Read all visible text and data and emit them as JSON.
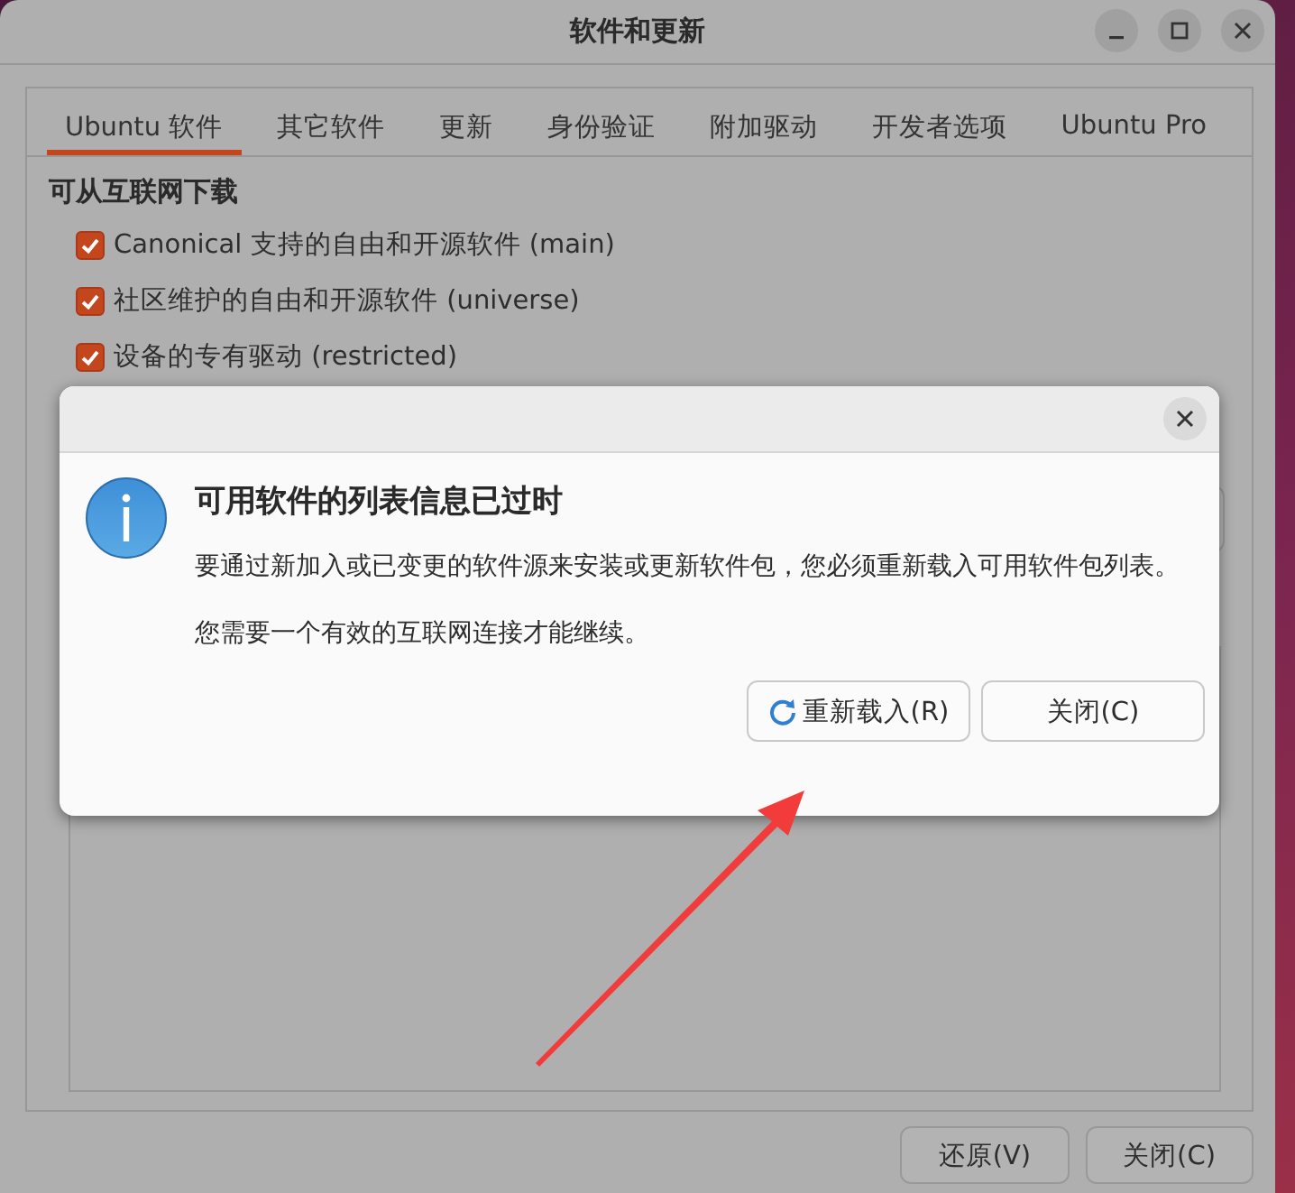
{
  "window": {
    "title": "软件和更新"
  },
  "tabs": [
    {
      "label": "Ubuntu 软件",
      "selected": true
    },
    {
      "label": "其它软件",
      "selected": false
    },
    {
      "label": "更新",
      "selected": false
    },
    {
      "label": "身份验证",
      "selected": false
    },
    {
      "label": "附加驱动",
      "selected": false
    },
    {
      "label": "开发者选项",
      "selected": false
    },
    {
      "label": "Ubuntu Pro",
      "selected": false
    }
  ],
  "downloads": {
    "heading": "可从互联网下载",
    "sources": [
      {
        "label": "Canonical 支持的自由和开源软件 (main)",
        "checked": true
      },
      {
        "label": "社区维护的自由和开源软件 (universe)",
        "checked": true
      },
      {
        "label": "设备的专有驱动 (restricted)",
        "checked": true
      }
    ]
  },
  "buttons": [
    "还原(V)",
    "关闭(C)"
  ],
  "dialog": {
    "title": "可用软件的列表信息已过时",
    "paragraphs": [
      "要通过新加入或已变更的软件源来安装或更新软件包，您必须重新载入可用软件包列表。",
      "您需要一个有效的互联网连接才能继续。"
    ],
    "buttons": [
      {
        "label": "重新载入(R)",
        "kind": "reload"
      },
      {
        "label": "关闭(C)",
        "kind": "plain"
      }
    ]
  }
}
